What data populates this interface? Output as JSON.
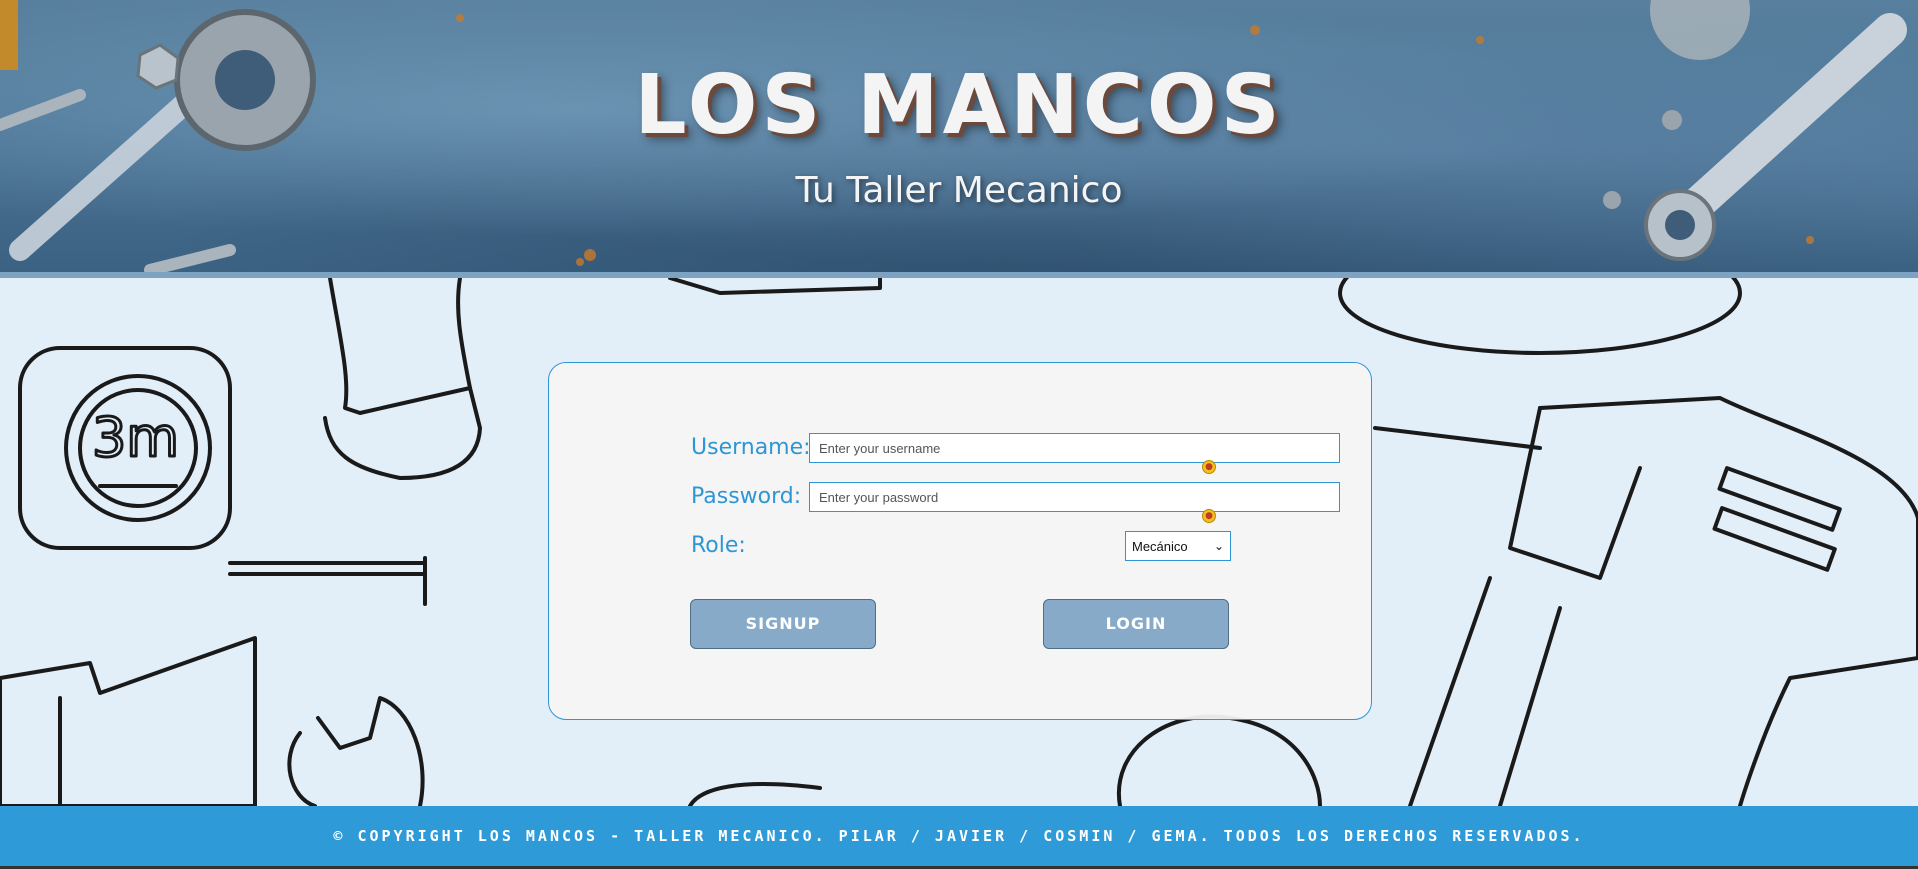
{
  "header": {
    "title": "LOS MANCOS",
    "subtitle": "Tu Taller Mecanico"
  },
  "login_form": {
    "username": {
      "label": "Username:",
      "placeholder": "Enter your username",
      "value": ""
    },
    "password": {
      "label": "Password:",
      "placeholder": "Enter your password",
      "value": ""
    },
    "role": {
      "label": "Role:",
      "selected": "Mecánico"
    },
    "signup_label": "SIGNUP",
    "login_label": "LOGIN"
  },
  "footer": {
    "text": "© COPYRIGHT LOS MANCOS - TALLER MECANICO. PILAR / JAVIER / COSMIN / GEMA. TODOS LOS DERECHOS RESERVADOS."
  },
  "colors": {
    "accent": "#2e9ad8",
    "button": "#86aac8",
    "card_background": "#f5f5f5",
    "page_background": "#e2eef8"
  }
}
